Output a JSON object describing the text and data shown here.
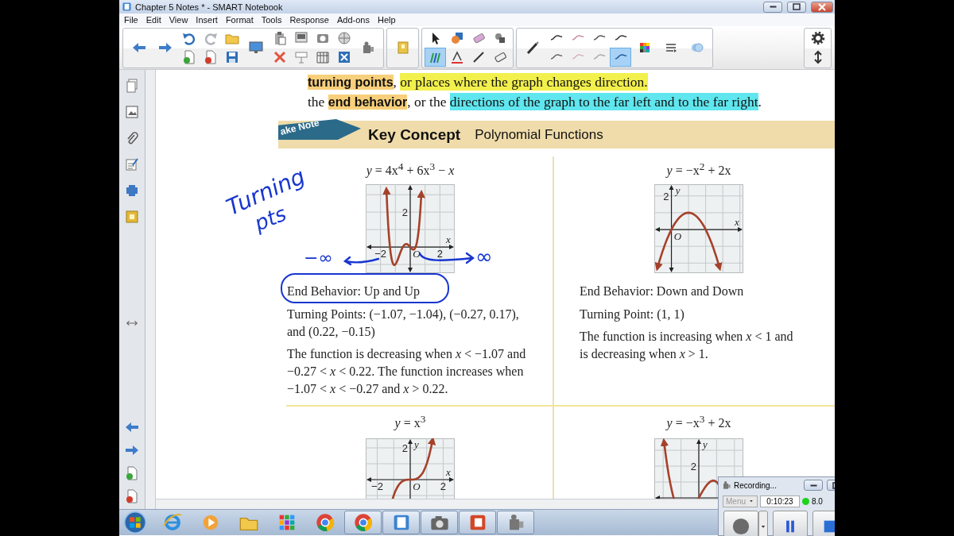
{
  "window": {
    "title": "Chapter 5 Notes * - SMART Notebook"
  },
  "menu": [
    "File",
    "Edit",
    "View",
    "Insert",
    "Format",
    "Tools",
    "Response",
    "Add-ons",
    "Help"
  ],
  "toolbar": {
    "tools": [
      {
        "selected": false
      },
      {
        "selected": true
      },
      {
        "selected": false
      },
      {
        "selected": false
      },
      {
        "selected": false
      },
      {
        "selected": false
      },
      {
        "selected": false
      },
      {
        "selected": false
      }
    ],
    "line_styles": [
      {
        "selected": false
      },
      {
        "selected": false
      },
      {
        "selected": false
      },
      {
        "selected": false
      },
      {
        "selected": false
      },
      {
        "selected": false
      },
      {
        "selected": false
      },
      {
        "selected": true
      }
    ]
  },
  "page": {
    "lines": [
      {
        "segments": [
          {
            "text": "turning points",
            "kind": "term",
            "color": "#f8cf7a"
          },
          {
            "text": ", ",
            "kind": "plain"
          },
          {
            "text": "or places where the graph changes direction.",
            "kind": "plain",
            "color": "#f2f04c"
          }
        ]
      },
      {
        "segments": [
          {
            "text": "the ",
            "kind": "plain"
          },
          {
            "text": "end behavior",
            "kind": "term",
            "color": "#f8cf7a"
          },
          {
            "text": ", or the ",
            "kind": "plain"
          },
          {
            "text": "directions of the graph to the far left and to the far right",
            "kind": "plain",
            "color": "#5fe6ee"
          },
          {
            "text": ".",
            "kind": "plain"
          }
        ]
      }
    ],
    "banner": {
      "ribbon": "ake Note",
      "title": "Key Concept",
      "subtitle": "Polynomial Functions"
    },
    "cells": [
      {
        "equation": "*y* = 4x$^{4}$ + 6x$^{3}$ − *x*",
        "graph": {
          "kind": "quartic",
          "labels": [
            {
              "kind": "y-tick",
              "text": "2"
            },
            {
              "kind": "x-axis",
              "text": "x"
            },
            {
              "kind": "x-tick",
              "text": "−2"
            },
            {
              "kind": "origin",
              "text": "O"
            },
            {
              "kind": "x-tick",
              "text": "2"
            }
          ]
        },
        "notes": [
          "End Behavior: Up and Up",
          "Turning Points: (−1.07, −1.04), (−0.27, 0.17), and (0.22, −0.15)",
          "The function is decreasing when *x* < −1.07 and −0.27 < *x* < 0.22. The function increases when −1.07 < *x* < −0.27 and *x* > 0.22."
        ]
      },
      {
        "equation": "*y* = −x$^{2}$ + 2x",
        "graph": {
          "kind": "parabola",
          "labels": [
            {
              "kind": "y-tick",
              "text": "2"
            },
            {
              "kind": "y-axis",
              "text": "y"
            },
            {
              "kind": "x-axis",
              "text": "x"
            },
            {
              "kind": "origin",
              "text": "O"
            }
          ]
        },
        "notes": [
          "End Behavior: Down and Down",
          "Turning Point: (1, 1)",
          "The function is increasing when *x* < 1 and is decreasing when *x* > 1."
        ]
      },
      {
        "equation": "*y* = x$^{3}$",
        "graph": {
          "kind": "cubic",
          "labels": [
            {
              "kind": "y-tick",
              "text": "2"
            },
            {
              "kind": "y-axis",
              "text": "y"
            },
            {
              "kind": "x-axis",
              "text": "x"
            },
            {
              "kind": "x-tick",
              "text": "−2"
            },
            {
              "kind": "origin",
              "text": "O"
            },
            {
              "kind": "x-tick",
              "text": "2"
            }
          ]
        }
      },
      {
        "equation": "*y* = −x$^{3}$ + 2x",
        "graph": {
          "kind": "negative-cubic",
          "labels": [
            {
              "kind": "y-axis",
              "text": "y"
            },
            {
              "kind": "y-tick",
              "text": "2"
            }
          ]
        }
      }
    ],
    "ink": [
      {
        "kind": "text",
        "text": "Turning"
      },
      {
        "kind": "text",
        "text": "pts"
      },
      {
        "kind": "text",
        "text": "−∞"
      },
      {
        "kind": "arrow-left"
      },
      {
        "kind": "arrow-right"
      },
      {
        "kind": "text",
        "text": "∞"
      },
      {
        "kind": "circle"
      }
    ]
  },
  "recording": {
    "title": "Recording...",
    "menu": {
      "label": "Menu",
      "disabled": true
    },
    "time": "0:10:23",
    "size": "8.0"
  },
  "taskbar": [
    {
      "running": false
    },
    {
      "running": false
    },
    {
      "running": false
    },
    {
      "running": false
    },
    {
      "running": false
    },
    {
      "running": true
    },
    {
      "running": true
    },
    {
      "running": true
    },
    {
      "running": true
    },
    {
      "running": true
    }
  ]
}
